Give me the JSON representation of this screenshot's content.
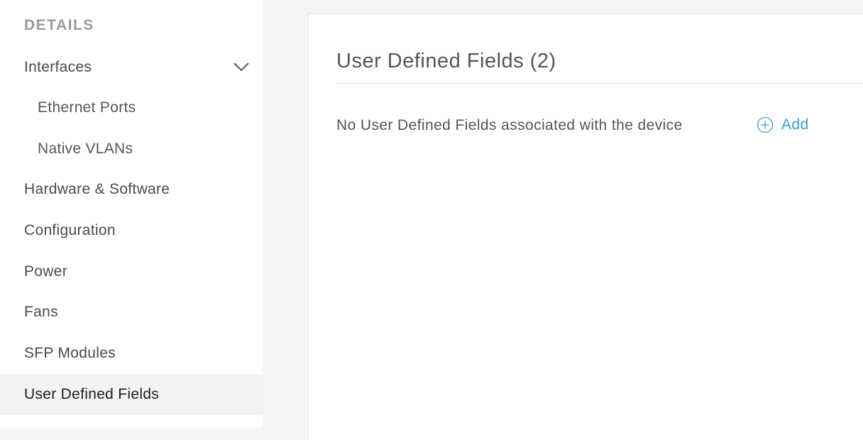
{
  "sidebar": {
    "heading": "DETAILS",
    "items": [
      {
        "label": "Interfaces",
        "icon": "chevron-down-icon"
      },
      {
        "label": "Ethernet Ports"
      },
      {
        "label": "Native VLANs"
      },
      {
        "label": "Hardware & Software"
      },
      {
        "label": "Configuration"
      },
      {
        "label": "Power"
      },
      {
        "label": "Fans"
      },
      {
        "label": "SFP Modules"
      },
      {
        "label": "User Defined Fields",
        "active": true
      }
    ]
  },
  "main": {
    "title": "User Defined Fields (2)",
    "empty_message": "No User Defined Fields associated with the device",
    "add_label": "Add",
    "add_icon": "plus-circle-icon"
  },
  "colors": {
    "accent": "#3a9ecb",
    "active_item_bg": "#f3f3f3",
    "page_bg": "#f5f5f5"
  }
}
